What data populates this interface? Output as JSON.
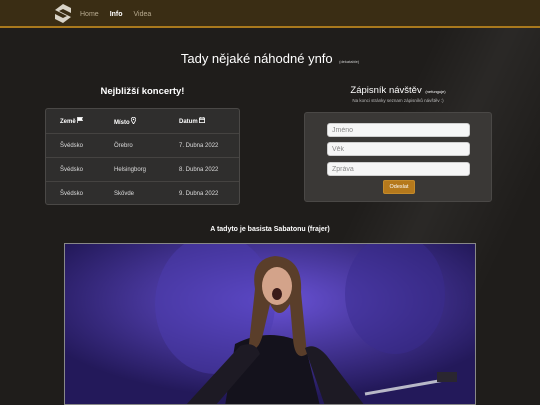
{
  "nav": {
    "logo_icon": "sabaton-logo-icon",
    "links": [
      {
        "label": "Home",
        "active": false
      },
      {
        "label": "Info",
        "active": true
      },
      {
        "label": "Videa",
        "active": false
      }
    ],
    "accent_color": "#a9791d"
  },
  "header": {
    "title": "Tady nějaké náhodné ynfo",
    "note": "(dekatable)"
  },
  "concerts": {
    "title": "Nejbližší koncerty!",
    "columns": [
      {
        "label": "Země",
        "icon": "flag-icon"
      },
      {
        "label": "Místo",
        "icon": "map-marker-icon"
      },
      {
        "label": "Datum",
        "icon": "calendar-icon"
      }
    ],
    "rows": [
      {
        "country": "Švédsko",
        "place": "Örebro",
        "date": "7. Dubna 2022"
      },
      {
        "country": "Švédsko",
        "place": "Helsingborg",
        "date": "8. Dubna 2022"
      },
      {
        "country": "Švédsko",
        "place": "Skövde",
        "date": "9. Dubna 2022"
      }
    ]
  },
  "guestbook": {
    "title": "Zápisník návštěv",
    "title_note": "(nefunguje)",
    "subtitle": "Na konci stránky seznam zápisníků návštěv :)",
    "fields": [
      {
        "placeholder": "Jméno"
      },
      {
        "placeholder": "Věk"
      },
      {
        "placeholder": "Zpráva"
      }
    ],
    "submit_label": "Odeslat",
    "button_color": "#b5791c"
  },
  "bassist": {
    "caption": "A tadyto je basista Sabatonu (frajer)"
  }
}
